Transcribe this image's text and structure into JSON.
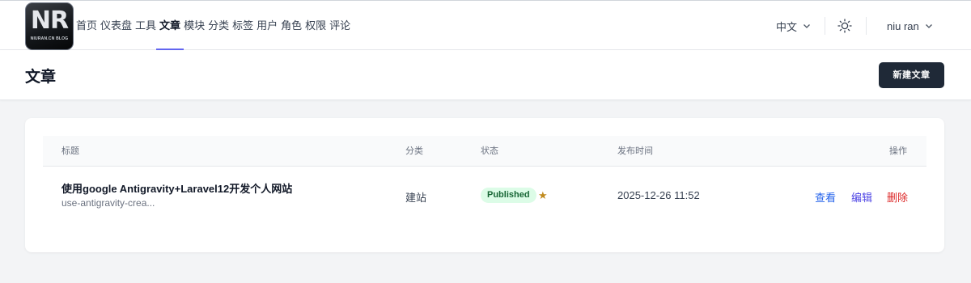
{
  "logo": {
    "mark": "NR",
    "sub": "NIURAN.CN BLOG"
  },
  "nav": {
    "items": [
      {
        "label": "首页",
        "name": "nav-item-home"
      },
      {
        "label": "仪表盘",
        "name": "nav-item-dashboard"
      },
      {
        "label": "工具",
        "name": "nav-item-tools"
      },
      {
        "label": "文章",
        "name": "nav-item-articles",
        "active": true
      },
      {
        "label": "模块",
        "name": "nav-item-modules"
      },
      {
        "label": "分类",
        "name": "nav-item-categories"
      },
      {
        "label": "标签",
        "name": "nav-item-tags"
      },
      {
        "label": "用户",
        "name": "nav-item-users"
      },
      {
        "label": "角色",
        "name": "nav-item-roles"
      },
      {
        "label": "权限",
        "name": "nav-item-permissions"
      },
      {
        "label": "评论",
        "name": "nav-item-comments"
      }
    ],
    "active_color": "#6366f1"
  },
  "header_right": {
    "language": "中文",
    "theme_icon": "sun-icon",
    "user_name": "niu ran"
  },
  "page": {
    "title": "文章",
    "new_button": "新建文章"
  },
  "table": {
    "columns": [
      "标题",
      "分类",
      "状态",
      "发布时间",
      "操作"
    ],
    "rows": [
      {
        "title": "使用google Antigravity+Laravel12开发个人网站",
        "slug": "use-antigravity-crea...",
        "category": "建站",
        "status": "Published",
        "featured_icon": "star-icon",
        "published_at": "2025-12-26 11:52",
        "actions": {
          "view": "查看",
          "edit": "编辑",
          "delete": "删除"
        }
      }
    ]
  },
  "colors": {
    "primary_button": "#1f2937",
    "status_published_bg": "#dcfce7",
    "status_published_text": "#166534",
    "link_view": "#2563eb",
    "link_edit": "#4f46e5",
    "link_delete": "#dc2626",
    "star": "#c08a1e"
  }
}
